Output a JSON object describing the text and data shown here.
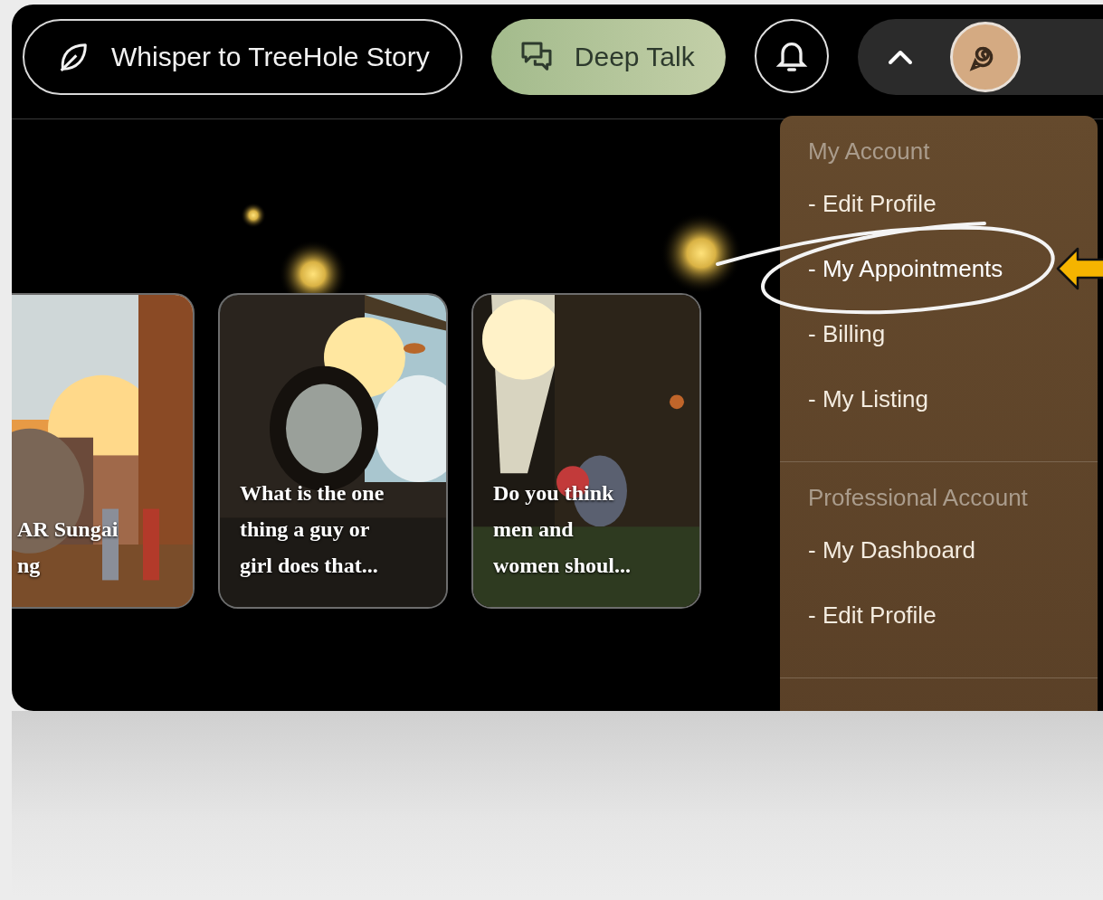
{
  "header": {
    "buttons": [
      {
        "label": "Whisper to TreeHole Story",
        "kind": "outline"
      },
      {
        "label": "Deep Talk",
        "kind": "filled"
      }
    ],
    "menu_expanded": true
  },
  "cards": [
    {
      "title": "AR Sungai\nng",
      "kind": "picture"
    },
    {
      "title": "What is the one\nthing a guy or\ngirl does that...",
      "kind": "picture"
    },
    {
      "title": "Do you think\nmen and\nwomen shoul...",
      "kind": "picture"
    }
  ],
  "menu": {
    "sections": [
      {
        "title": "My Account",
        "items": [
          {
            "label": "- Edit Profile",
            "circled": false
          },
          {
            "label": "- My Appointments",
            "circled": true
          },
          {
            "label": "- Billing",
            "circled": false
          },
          {
            "label": "- My Listing",
            "circled": false
          }
        ]
      },
      {
        "title": "Professional Account",
        "items": [
          {
            "label": "- My Dashboard",
            "circled": false
          },
          {
            "label": "- Edit Profile",
            "circled": false
          }
        ]
      }
    ]
  }
}
